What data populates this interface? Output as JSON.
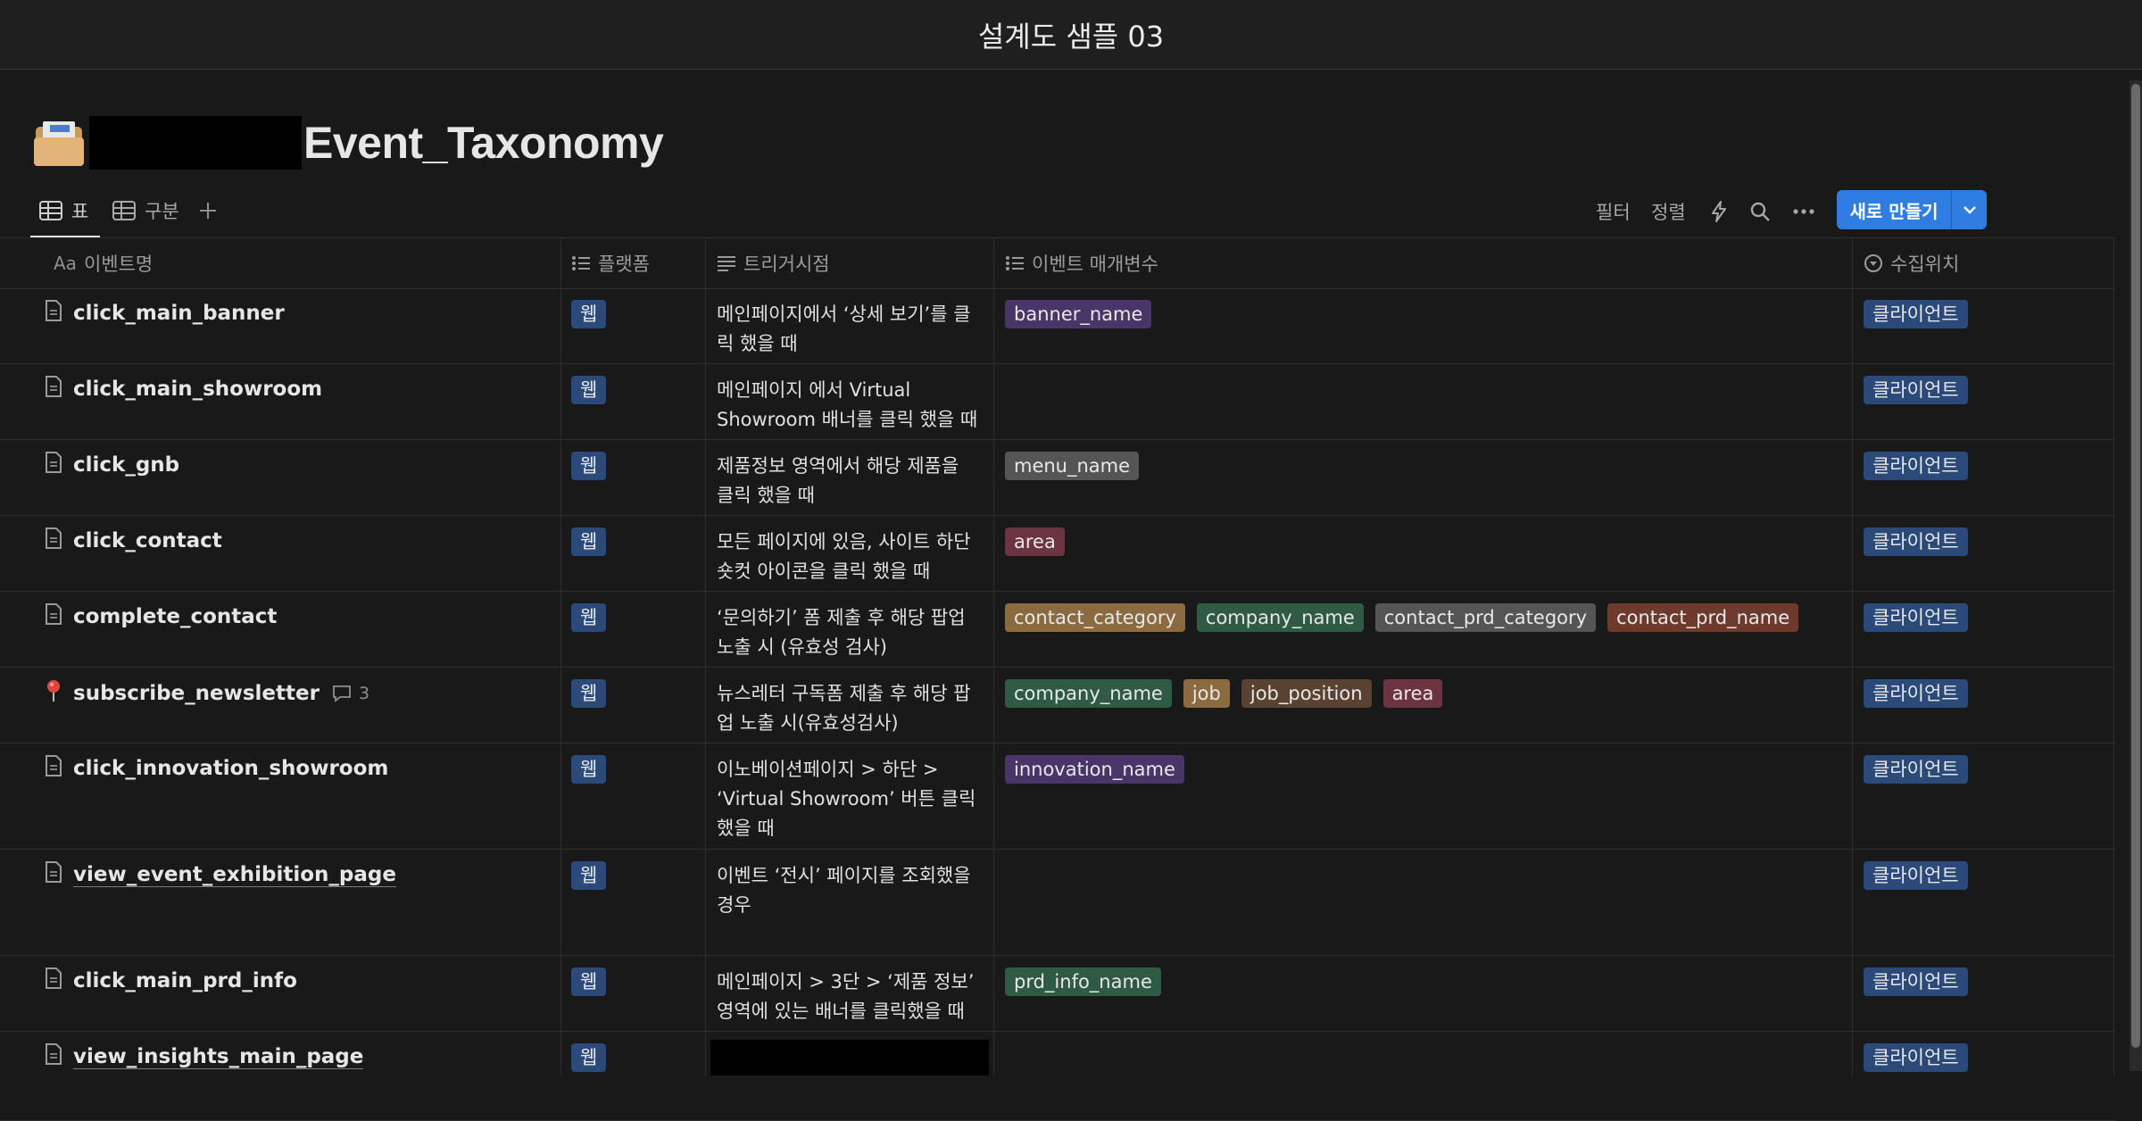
{
  "window": {
    "title": "설계도 샘플 03"
  },
  "page": {
    "title": "Event_Taxonomy"
  },
  "views": [
    {
      "label": "표",
      "icon": "table-icon",
      "active": true
    },
    {
      "label": "구분",
      "icon": "table-icon",
      "active": false
    }
  ],
  "toolbar": {
    "filter": "필터",
    "sort": "정렬",
    "new_button": "새로 만들기"
  },
  "columns": [
    {
      "label": "이벤트명",
      "icon": "title-icon"
    },
    {
      "label": "플랫폼",
      "icon": "list-icon"
    },
    {
      "label": "트리거시점",
      "icon": "text-icon"
    },
    {
      "label": "이벤트 매개변수",
      "icon": "list-icon"
    },
    {
      "label": "수집위치",
      "icon": "select-icon"
    }
  ],
  "rows": [
    {
      "name": "click_main_banner",
      "platform": "웹",
      "trigger_1": "메인페이지에서 ‘상세 보기’를 클",
      "trigger_2": "릭 했을 때",
      "trigger_3": "",
      "params": [
        "banner_name"
      ],
      "location": "클라이언트"
    },
    {
      "name": "click_main_showroom",
      "platform": "웹",
      "trigger_1": "메인페이지 에서 Virtual",
      "trigger_2": "Showroom 배너를 클릭 했을 때",
      "trigger_3": "",
      "params": [],
      "location": "클라이언트"
    },
    {
      "name": "click_gnb",
      "platform": "웹",
      "trigger_1": "제품정보 영역에서 해당 제품을",
      "trigger_2": "클릭 했을 때",
      "trigger_3": "",
      "params": [
        "menu_name"
      ],
      "location": "클라이언트"
    },
    {
      "name": "click_contact",
      "platform": "웹",
      "trigger_1": "모든 페이지에 있음, 사이트 하단",
      "trigger_2": "숏컷 아이콘을 클릭 했을 때",
      "trigger_3": "",
      "params": [
        "area"
      ],
      "location": "클라이언트"
    },
    {
      "name": "complete_contact",
      "platform": "웹",
      "trigger_1": "‘문의하기’ 폼 제출 후 해당 팝업",
      "trigger_2": "노출 시 (유효성 검사)",
      "trigger_3": "",
      "params": [
        "contact_category",
        "company_name",
        "contact_prd_category",
        "contact_prd_name"
      ],
      "location": "클라이언트"
    },
    {
      "name": "subscribe_newsletter",
      "comment_count": "3",
      "platform": "웹",
      "trigger_1": "뉴스레터 구독폼 제출 후 해당 팝",
      "trigger_2": "업 노출 시(유효성검사)",
      "trigger_3": "",
      "params": [
        "company_name",
        "job",
        "job_position",
        "area"
      ],
      "location": "클라이언트"
    },
    {
      "name": "click_innovation_showroom",
      "platform": "웹",
      "trigger_1": "이노베이션페이지 > 하단 >",
      "trigger_2": "‘Virtual Showroom’ 버튼 클릭",
      "trigger_3": "했을 때",
      "params": [
        "innovation_name"
      ],
      "location": "클라이언트"
    },
    {
      "name": "view_event_exhibition_page",
      "platform": "웹",
      "trigger_1": "이벤트 ‘전시’ 페이지를 조회했을",
      "trigger_2": "경우",
      "trigger_3": "",
      "params": [],
      "location": "클라이언트"
    },
    {
      "name": "click_main_prd_info",
      "platform": "웹",
      "trigger_1": "메인페이지 > 3단 > ‘제품 정보’",
      "trigger_2": "영역에 있는 배너를 클릭했을 때",
      "trigger_3": "",
      "params": [
        "prd_info_name"
      ],
      "location": "클라이언트"
    },
    {
      "name": "view_insights_main_page",
      "platform": "웹",
      "trigger_1": "",
      "trigger_2": "",
      "trigger_3": "",
      "params": [],
      "location": "클라이언트"
    }
  ],
  "colors": {
    "background": "#191919",
    "accent": "#2f7de0",
    "tag_blue": "#2b4a7a"
  }
}
